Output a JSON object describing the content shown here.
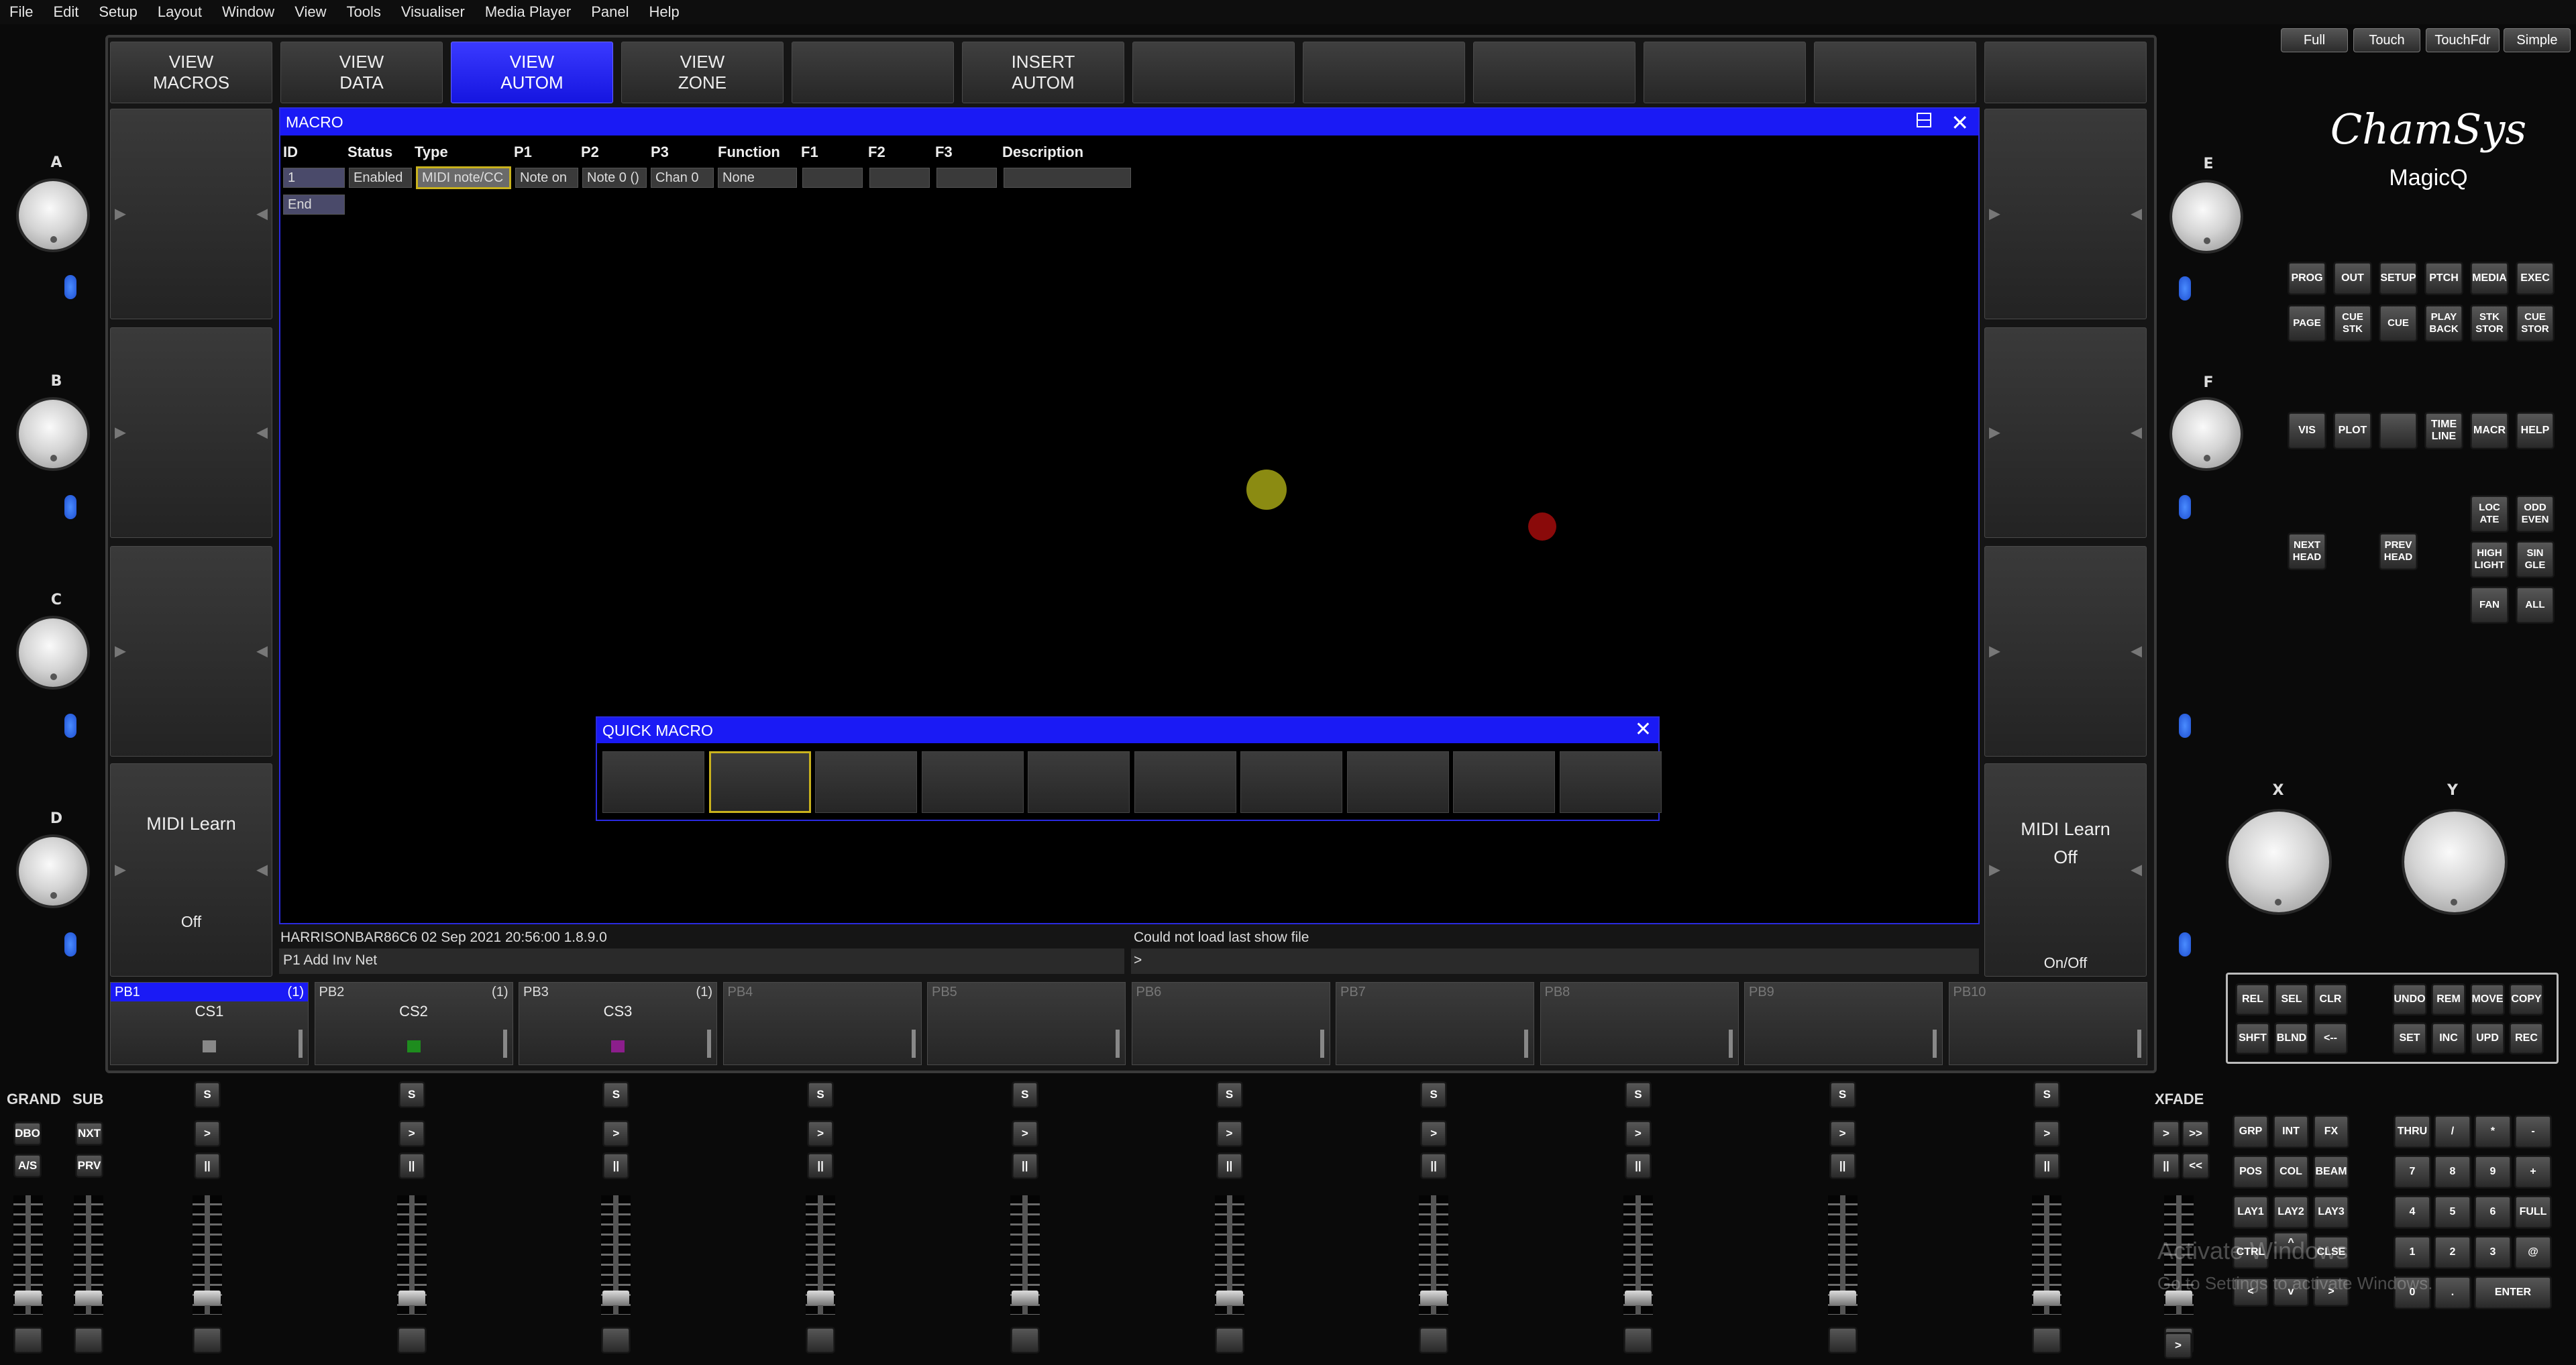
{
  "menu": [
    "File",
    "Edit",
    "Setup",
    "Layout",
    "Window",
    "View",
    "Tools",
    "Visualiser",
    "Media Player",
    "Panel",
    "Help"
  ],
  "modes": [
    "Full",
    "Touch",
    "TouchFdr",
    "Simple"
  ],
  "brand": {
    "line1": "ChamSys",
    "line2": "MagicQ"
  },
  "top_buttons": [
    {
      "l1": "VIEW",
      "l2": "MACROS"
    },
    {
      "l1": "VIEW",
      "l2": "DATA"
    },
    {
      "l1": "VIEW",
      "l2": "AUTOM"
    },
    {
      "l1": "VIEW",
      "l2": "ZONE"
    },
    {
      "l1": "",
      "l2": ""
    },
    {
      "l1": "INSERT",
      "l2": "AUTOM"
    },
    {
      "l1": "",
      "l2": ""
    },
    {
      "l1": "",
      "l2": ""
    },
    {
      "l1": "",
      "l2": ""
    },
    {
      "l1": "",
      "l2": ""
    },
    {
      "l1": "",
      "l2": ""
    },
    {
      "l1": "",
      "l2": ""
    }
  ],
  "knobs_left": [
    "A",
    "B",
    "C",
    "D"
  ],
  "knobs_right": [
    "E",
    "F"
  ],
  "knobs_xy": [
    "X",
    "Y"
  ],
  "midi_left": {
    "title": "MIDI Learn",
    "state": "Off"
  },
  "midi_right": {
    "title": "MIDI Learn",
    "state": "Off",
    "onoff": "On/Off"
  },
  "macro": {
    "title": "MACRO",
    "headers": [
      "ID",
      "Status",
      "Type",
      "P1",
      "P2",
      "P3",
      "Function",
      "F1",
      "F2",
      "F3",
      "Description"
    ],
    "row1": {
      "id": "1",
      "status": "Enabled",
      "type": "MIDI note/CC",
      "p1": "Note on",
      "p2": "Note 0 ()",
      "p3": "Chan 0",
      "function": "None",
      "f1": "",
      "f2": "",
      "f3": "",
      "description": ""
    },
    "row2": {
      "id": "End"
    }
  },
  "quick_macro": {
    "title": "QUICK MACRO"
  },
  "status": {
    "left1": "HARRISONBAR86C6 02 Sep 2021 20:56:00 1.8.9.0",
    "left2": "P1  Add Inv Net",
    "right1": "Could not load last show file",
    "right2": ">"
  },
  "playbacks": [
    {
      "name": "PB1",
      "count": "(1)",
      "cs": "CS1",
      "color": "#888888"
    },
    {
      "name": "PB2",
      "count": "(1)",
      "cs": "CS2",
      "color": "#1e8c1e"
    },
    {
      "name": "PB3",
      "count": "(1)",
      "cs": "CS3",
      "color": "#8c1e8c"
    },
    {
      "name": "PB4",
      "count": "",
      "cs": "",
      "color": ""
    },
    {
      "name": "PB5",
      "count": "",
      "cs": "",
      "color": ""
    },
    {
      "name": "PB6",
      "count": "",
      "cs": "",
      "color": ""
    },
    {
      "name": "PB7",
      "count": "",
      "cs": "",
      "color": ""
    },
    {
      "name": "PB8",
      "count": "",
      "cs": "",
      "color": ""
    },
    {
      "name": "PB9",
      "count": "",
      "cs": "",
      "color": ""
    },
    {
      "name": "PB10",
      "count": "",
      "cs": "",
      "color": ""
    }
  ],
  "window_btns": {
    "row1": [
      "PROG",
      "OUT",
      "SETUP",
      "PTCH",
      "MEDIA",
      "EXEC"
    ],
    "row2": [
      "PAGE",
      "CUE STK",
      "CUE",
      "PLAY BACK",
      "STK STOR",
      "CUE STOR"
    ],
    "row3": [
      "VIS",
      "PLOT",
      "",
      "TIME LINE",
      "MACR",
      "HELP"
    ]
  },
  "head_btns": {
    "next": "NEXT HEAD",
    "prev": "PREV HEAD",
    "loc": "LOC ATE",
    "odd": "ODD EVEN",
    "high": "HIGH LIGHT",
    "single": "SIN GLE",
    "fan": "FAN",
    "all": "ALL"
  },
  "keys_top": [
    "REL",
    "SEL",
    "CLR",
    "UNDO",
    "REM",
    "MOVE",
    "COPY",
    "SHFT",
    "BLND",
    "<--",
    "SET",
    "INC",
    "UPD",
    "REC"
  ],
  "keys_left": [
    "GRP",
    "INT",
    "FX",
    "POS",
    "COL",
    "BEAM",
    "LAY1",
    "LAY2",
    "LAY3",
    "CTRL",
    "",
    "CLSE",
    "",
    "^",
    "",
    "<",
    "v",
    ">"
  ],
  "keypad": [
    "THRU",
    "/",
    "*",
    "-",
    "7",
    "8",
    "9",
    "+",
    "4",
    "5",
    "6",
    "FULL",
    "1",
    "2",
    "3",
    "@",
    "0",
    ".",
    "ENTER"
  ],
  "master": {
    "grand": "GRAND",
    "sub": "SUB",
    "dbo": "DBO",
    "nxt": "NXT",
    "as": "A/S",
    "prv": "PRV",
    "xfade": "XFADE"
  },
  "pb_controls": {
    "s": "S",
    "go": ">",
    "pause": "||"
  },
  "xfade_btns": [
    ">",
    ">>",
    "||",
    "<<",
    ">"
  ],
  "watermark": {
    "line1": "Activate Windows",
    "line2": "Go to Settings to activate Windows."
  }
}
